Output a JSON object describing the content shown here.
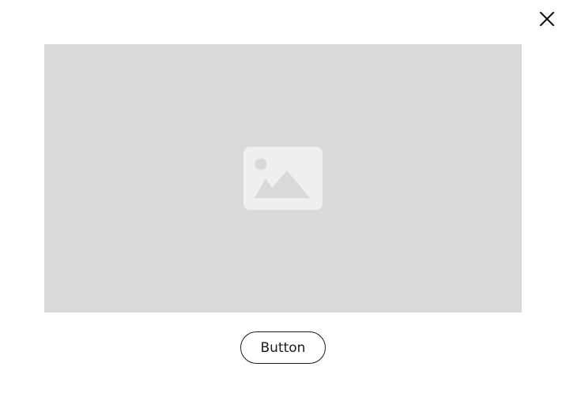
{
  "dialog": {
    "close_icon": "close-icon",
    "media": {
      "icon": "image-placeholder-icon"
    },
    "button_label": "Button"
  },
  "colors": {
    "background": "#ffffff",
    "media_fill": "#d9d9d9",
    "placeholder_fill": "#efefef",
    "placeholder_glyph": "#d9d9d9",
    "text": "#1c1c1c"
  }
}
